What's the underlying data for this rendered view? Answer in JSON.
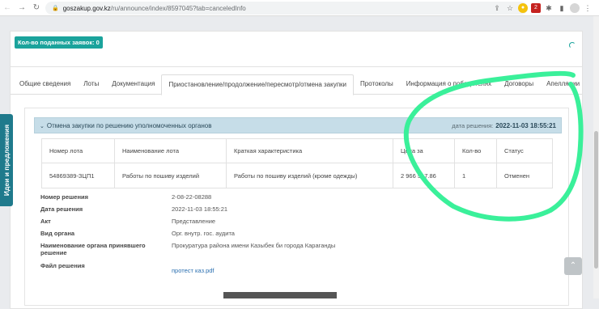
{
  "browser": {
    "url_host": "goszakup.gov.kz",
    "url_path": "/ru/announce/index/8597045?tab=canceledInfo",
    "ext_badge": "2"
  },
  "top_panel": {
    "applications_count": "Кол-во поданных заявок: 0"
  },
  "tabs": [
    {
      "label": "Общие сведения"
    },
    {
      "label": "Лоты"
    },
    {
      "label": "Документация"
    },
    {
      "label": "Приостановление/продолжение/пересмотр/отмена закупки",
      "active": true
    },
    {
      "label": "Протоколы"
    },
    {
      "label": "Информация о победителях"
    },
    {
      "label": "Договоры"
    },
    {
      "label": "Апелляции"
    }
  ],
  "section": {
    "title": "Отмена закупки по решению уполномоченных органов",
    "date_label": "дата решения:",
    "date_value": "2022-11-03 18:55:21"
  },
  "lots_table": {
    "headers": [
      "Номер лота",
      "Наименование лота",
      "Краткая характеристика",
      "Цена за",
      "Кол-во",
      "Статус"
    ],
    "rows": [
      [
        "54869389-ЗЦП1",
        "Работы по пошиву изделий",
        "Работы по пошиву изделий (кроме одежды)",
        "2 966 517.86",
        "1",
        "Отменен"
      ]
    ]
  },
  "details": [
    {
      "label": "Номер решения",
      "value": "2-08-22-08288"
    },
    {
      "label": "Дата решения",
      "value": "2022-11-03 18:55:21"
    },
    {
      "label": "Акт",
      "value": "Представление"
    },
    {
      "label": "Вид органа",
      "value": "Орг. внутр. гос. аудита"
    },
    {
      "label": "Наименование органа принявшего решение",
      "value": "Прокуратура района имени Казыбек би города Караганды"
    },
    {
      "label": "Файл решения",
      "value": "протест каз.pdf",
      "link": true
    }
  ],
  "side_tab": {
    "label": "Идеи и предложения"
  },
  "colors": {
    "accent": "#1ba39c",
    "annotation": "#3af09a",
    "header_bg": "#c6dde8"
  }
}
